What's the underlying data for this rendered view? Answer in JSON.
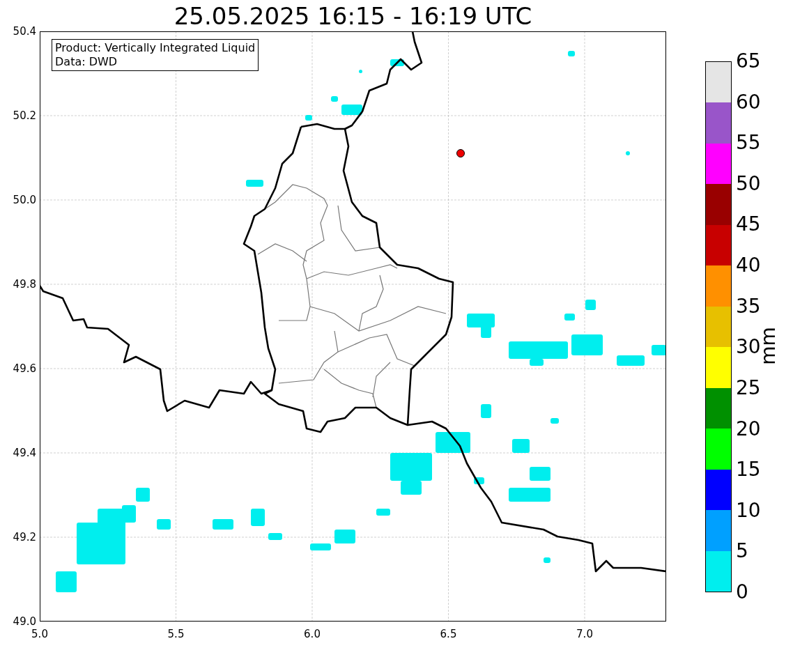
{
  "title": "25.05.2025 16:15 - 16:19 UTC",
  "map": {
    "legend": [
      "Product: Vertically Integrated Liquid",
      "Data: DWD"
    ],
    "x_ticks": [
      "5.0",
      "5.5",
      "6.0",
      "6.5",
      "7.0"
    ],
    "y_ticks": [
      "50.4",
      "50.2",
      "50.0",
      "49.8",
      "49.6",
      "49.4",
      "49.2",
      "49.0"
    ]
  },
  "colorbar": {
    "label": "mm",
    "bins": [
      {
        "color": "#e5e5e5"
      },
      {
        "color": "#9955c9"
      },
      {
        "color": "#ff00ff"
      },
      {
        "color": "#990000"
      },
      {
        "color": "#c80000"
      },
      {
        "color": "#ff9000"
      },
      {
        "color": "#e7c000"
      },
      {
        "color": "#ffff00"
      },
      {
        "color": "#009000"
      },
      {
        "color": "#00ff00"
      },
      {
        "color": "#0000ff"
      },
      {
        "color": "#00a0ff"
      },
      {
        "color": "#00eeee"
      }
    ],
    "ticks": [
      "65",
      "60",
      "55",
      "50",
      "45",
      "40",
      "35",
      "30",
      "25",
      "20",
      "15",
      "10",
      "5",
      "0"
    ]
  }
}
